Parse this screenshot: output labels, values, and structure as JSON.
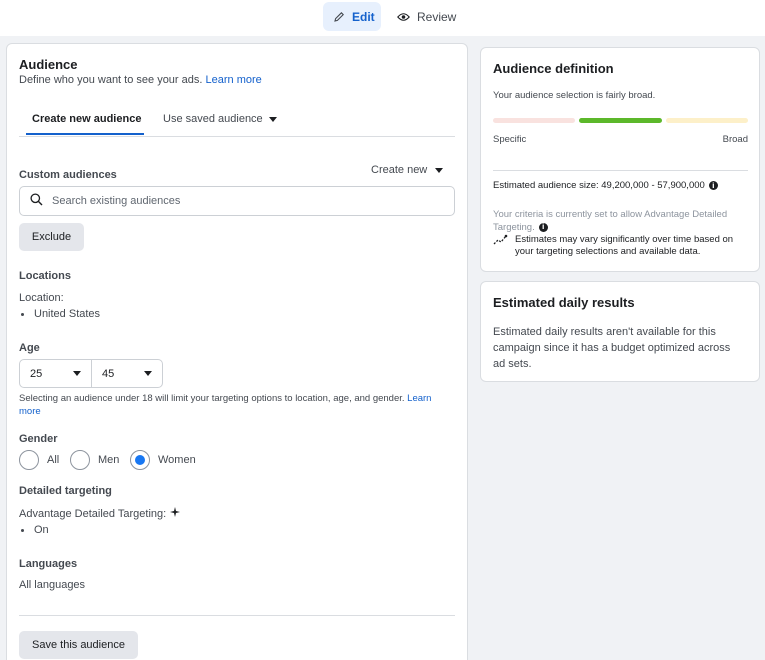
{
  "topbar": {
    "edit_label": "Edit",
    "review_label": "Review",
    "edit_icon": "pencil-icon",
    "review_icon": "eye-icon"
  },
  "audience": {
    "title": "Audience",
    "subtitle": "Define who you want to see your ads.",
    "learn_more": "Learn more",
    "tabs": [
      {
        "label": "Create new audience",
        "active": true
      },
      {
        "label": "Use saved audience",
        "active": false
      }
    ],
    "custom_audiences": {
      "label": "Custom audiences",
      "create_new": "Create new",
      "search_placeholder": "Search existing audiences",
      "exclude_label": "Exclude"
    },
    "locations": {
      "label": "Locations",
      "location_label": "Location:",
      "items": [
        "United States"
      ]
    },
    "age": {
      "label": "Age",
      "min": "25",
      "max": "45",
      "note": "Selecting an audience under 18 will limit your targeting options to location, age, and gender.",
      "note_link_1": "Learn",
      "note_link_2": "more"
    },
    "gender": {
      "label": "Gender",
      "options": [
        "All",
        "Men",
        "Women"
      ],
      "selected": "Women"
    },
    "detailed_targeting": {
      "label": "Detailed targeting",
      "advantage_label": "Advantage Detailed Targeting:",
      "items": [
        "On"
      ]
    },
    "languages": {
      "label": "Languages",
      "value": "All languages"
    },
    "save_label": "Save this audience"
  },
  "definition": {
    "title": "Audience definition",
    "status": "Your audience selection is fairly broad.",
    "meter_left": "Specific",
    "meter_right": "Broad",
    "meter_colors": [
      "#f9e2df",
      "#5cb82a",
      "#fdf0c9"
    ],
    "size_label": "Estimated audience size: 49,200,000 - 57,900,000",
    "criteria_line1": "Your criteria is currently set to allow Advantage Detailed",
    "criteria_line2": "Targeting.",
    "estimates_line1": "Estimates may vary significantly over time based on",
    "estimates_line2": "your targeting selections and available data."
  },
  "daily_results": {
    "title": "Estimated daily results",
    "line1": "Estimated daily results aren't available for this",
    "line2": "campaign since it has a budget optimized across",
    "line3": "ad sets."
  }
}
